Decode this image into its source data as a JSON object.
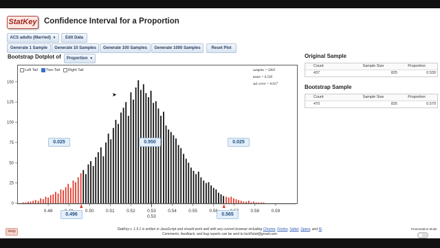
{
  "app": {
    "logo_text": "StatKey",
    "title": "Confidence Interval for a Proportion"
  },
  "dataset": {
    "selected": "ACS adults (Married)",
    "edit_label": "Edit Data"
  },
  "generate": {
    "one": "Generate 1 Sample",
    "ten": "Generate 10 Samples",
    "hundred": "Generate 100 Samples",
    "thousand": "Generate 1000 Samples",
    "reset": "Reset Plot"
  },
  "dotplot": {
    "heading": "Bootstrap Dotplot of",
    "variable": "Proportion",
    "tails": {
      "left": "Left Tail",
      "two": "Two-Tail",
      "right": "Right Tail",
      "selected": "two"
    },
    "stats": {
      "samples": "samples = 5003",
      "mean": "mean = 0.530",
      "se": "std. error = 0.017"
    },
    "left_prop": "0.025",
    "center_prop": "0.950",
    "right_prop": "0.025",
    "lower_cutoff": "0.496",
    "upper_cutoff": "0.565",
    "center_marker": "0.53"
  },
  "chart_data": {
    "type": "bar",
    "title": "",
    "xlabel": "",
    "ylabel": "",
    "xlim": [
      0.465,
      0.6
    ],
    "ylim": [
      0,
      160
    ],
    "y_ticks": [
      0,
      25,
      50,
      75,
      100,
      125,
      150
    ],
    "x_ticks": [
      "0.48",
      "0.49",
      "0.50",
      "0.51",
      "0.52",
      "0.53",
      "0.54",
      "0.55",
      "0.56",
      "0.57",
      "0.58",
      "0.59"
    ],
    "x_tick_values": [
      0.48,
      0.49,
      0.5,
      0.51,
      0.52,
      0.53,
      0.54,
      0.55,
      0.56,
      0.57,
      0.58,
      0.59
    ],
    "lower_cutoff": 0.496,
    "upper_cutoff": 0.565,
    "tail_color": "#e0392b",
    "body_color": "#111111",
    "x": [
      0.4679,
      0.4691,
      0.4703,
      0.4715,
      0.4727,
      0.4739,
      0.4752,
      0.4764,
      0.4776,
      0.4788,
      0.48,
      0.4812,
      0.4824,
      0.4836,
      0.4848,
      0.4861,
      0.4873,
      0.4885,
      0.4897,
      0.4909,
      0.4921,
      0.4933,
      0.4945,
      0.4958,
      0.497,
      0.4982,
      0.4994,
      0.5006,
      0.5018,
      0.503,
      0.5042,
      0.5055,
      0.5067,
      0.5079,
      0.5091,
      0.5103,
      0.5115,
      0.5127,
      0.5139,
      0.5152,
      0.5164,
      0.5176,
      0.5188,
      0.52,
      0.5212,
      0.5224,
      0.5236,
      0.5248,
      0.5261,
      0.5273,
      0.5285,
      0.5297,
      0.5309,
      0.5321,
      0.5333,
      0.5345,
      0.5358,
      0.537,
      0.5382,
      0.5394,
      0.5406,
      0.5418,
      0.543,
      0.5442,
      0.5455,
      0.5467,
      0.5479,
      0.5491,
      0.5503,
      0.5515,
      0.5527,
      0.5539,
      0.5552,
      0.5564,
      0.5576,
      0.5588,
      0.56,
      0.5612,
      0.5624,
      0.5636,
      0.5648,
      0.5661,
      0.5673,
      0.5685,
      0.5697,
      0.5709,
      0.5721,
      0.5733,
      0.5745,
      0.5758,
      0.577,
      0.5782,
      0.5794,
      0.5806,
      0.5818,
      0.583,
      0.5842
    ],
    "values": [
      1,
      1,
      2,
      2,
      3,
      4,
      3,
      6,
      5,
      8,
      7,
      10,
      11,
      14,
      12,
      17,
      16,
      20,
      24,
      19,
      28,
      26,
      32,
      37,
      41,
      36,
      48,
      52,
      46,
      57,
      63,
      69,
      58,
      75,
      86,
      79,
      93,
      103,
      98,
      112,
      118,
      125,
      108,
      137,
      128,
      143,
      152,
      140,
      147,
      136,
      131,
      139,
      124,
      126,
      117,
      108,
      113,
      96,
      91,
      88,
      84,
      80,
      72,
      68,
      61,
      55,
      50,
      44,
      40,
      36,
      39,
      32,
      28,
      25,
      26,
      22,
      19,
      17,
      13,
      11,
      9,
      8,
      7,
      8,
      6,
      5,
      4,
      3,
      2,
      2,
      3,
      1,
      2,
      1,
      1,
      1,
      1
    ]
  },
  "original_sample": {
    "title": "Original Sample",
    "headers": [
      "Count",
      "Sample Size",
      "Proportion"
    ],
    "values": [
      "437",
      "825",
      "0.530"
    ]
  },
  "bootstrap_sample": {
    "title": "Bootstrap Sample",
    "headers": [
      "Count",
      "Sample Size",
      "Proportion"
    ],
    "values": [
      "470",
      "825",
      "0.570"
    ]
  },
  "footer": {
    "help": "Help",
    "line1_pre": "StatKey v. 1.5.1 is written in JavaScript and should work well with any current browser including",
    "browsers": [
      "Chrome",
      "Firefox",
      "Safari",
      "Opera",
      "and",
      "IE"
    ],
    "line2": "Comments, feedback, and bug reports can be sent to lock5stat@gmail.com.",
    "presentation_mode": "Presentation Mode"
  }
}
